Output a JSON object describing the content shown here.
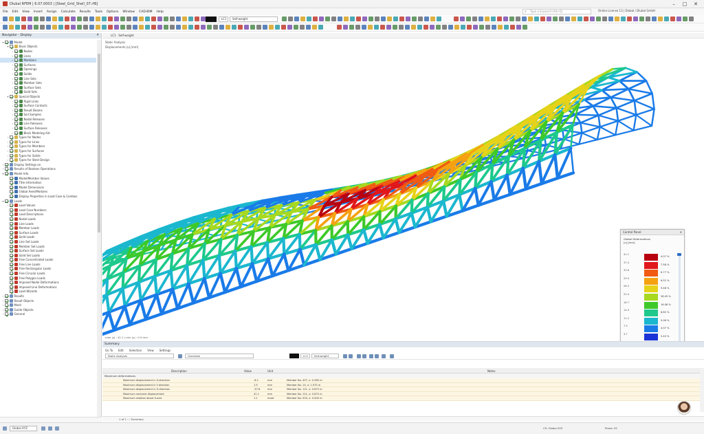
{
  "window": {
    "title": "Dlubal RFEM | 6.07.0003 | [Steel_Grid_Shell_07.rf6]",
    "controls": [
      "–",
      "□",
      "✕"
    ]
  },
  "menu": {
    "items": [
      "File",
      "Edit",
      "View",
      "Insert",
      "Assign",
      "Calculate",
      "Results",
      "Tools",
      "Options",
      "Window",
      "CAD-BIM",
      "Help"
    ],
    "search_placeholder": "Type a keyword (Alt+Q)",
    "license": "Online License 13 | Dlubal / Dlubal GmbH"
  },
  "toolbar": {
    "loadcase_code": "LC1",
    "loadcase_name": "Self-weight",
    "view_dropdown": "1 - Global XYZ"
  },
  "navigator": {
    "title": "Navigator - Display",
    "items": [
      {
        "label": "Model",
        "level": 0,
        "exp": "▾",
        "icon": "#6e8fbf"
      },
      {
        "label": "Basic Objects",
        "level": 1,
        "exp": "▾",
        "icon": "#d7b24a"
      },
      {
        "label": "Nodes",
        "level": 2,
        "exp": "›",
        "icon": "#4c8a4c"
      },
      {
        "label": "Lines",
        "level": 2,
        "exp": "›",
        "icon": "#4c8a4c"
      },
      {
        "label": "Members",
        "level": 2,
        "exp": "›",
        "icon": "#4c8a4c",
        "selected": true
      },
      {
        "label": "Surfaces",
        "level": 2,
        "exp": "›",
        "icon": "#4c8a4c"
      },
      {
        "label": "Openings",
        "level": 2,
        "exp": "›",
        "icon": "#4c8a4c"
      },
      {
        "label": "Solids",
        "level": 2,
        "exp": "›",
        "icon": "#4c8a4c"
      },
      {
        "label": "Line Sets",
        "level": 2,
        "exp": "›",
        "icon": "#4c8a4c"
      },
      {
        "label": "Member Sets",
        "level": 2,
        "exp": "›",
        "icon": "#4c8a4c"
      },
      {
        "label": "Surface Sets",
        "level": 2,
        "exp": "›",
        "icon": "#4c8a4c"
      },
      {
        "label": "Solid Sets",
        "level": 2,
        "exp": "›",
        "icon": "#4c8a4c"
      },
      {
        "label": "Special Objects",
        "level": 1,
        "exp": "▾",
        "icon": "#d7b24a"
      },
      {
        "label": "Rigid Links",
        "level": 2,
        "exp": "›",
        "icon": "#4c8a4c"
      },
      {
        "label": "Surface Contacts",
        "level": 2,
        "exp": "›",
        "icon": "#4c8a4c"
      },
      {
        "label": "Result Beams",
        "level": 2,
        "exp": "›",
        "icon": "#4c8a4c"
      },
      {
        "label": "Soil Samples",
        "level": 2,
        "exp": "›",
        "icon": "#4c8a4c"
      },
      {
        "label": "Nodal Releases",
        "level": 2,
        "exp": "›",
        "icon": "#4c8a4c"
      },
      {
        "label": "Line Releases",
        "level": 2,
        "exp": "›",
        "icon": "#4c8a4c"
      },
      {
        "label": "Surface Releases",
        "level": 2,
        "exp": "›",
        "icon": "#4c8a4c"
      },
      {
        "label": "Block Modeling Aid",
        "level": 2,
        "exp": "›",
        "icon": "#4c8a4c"
      },
      {
        "label": "Types for Nodes",
        "level": 1,
        "exp": "›",
        "icon": "#d7b24a"
      },
      {
        "label": "Types for Lines",
        "level": 1,
        "exp": "›",
        "icon": "#d7b24a"
      },
      {
        "label": "Types for Members",
        "level": 1,
        "exp": "›",
        "icon": "#d7b24a"
      },
      {
        "label": "Types for Surfaces",
        "level": 1,
        "exp": "›",
        "icon": "#d7b24a"
      },
      {
        "label": "Types for Solids",
        "level": 1,
        "exp": "›",
        "icon": "#d7b24a"
      },
      {
        "label": "Types for Steel Design",
        "level": 1,
        "exp": "›",
        "icon": "#d7b24a"
      },
      {
        "label": "Display Settings on",
        "level": 0,
        "exp": "›",
        "icon": "#6e8fbf"
      },
      {
        "label": "Results of Boolean Operations",
        "level": 0,
        "exp": "›",
        "icon": "#6e8fbf"
      },
      {
        "label": "Model Info",
        "level": 0,
        "exp": "▾",
        "icon": "#6e8fbf"
      },
      {
        "label": "Model/Member Values",
        "level": 1,
        "exp": "",
        "icon": "#3f6fb0"
      },
      {
        "label": "Title Information",
        "level": 1,
        "exp": "",
        "icon": "#3f6fb0"
      },
      {
        "label": "Model Dimensions",
        "level": 1,
        "exp": "",
        "icon": "#3f6fb0"
      },
      {
        "label": "Global Axes/Modules",
        "level": 1,
        "exp": "",
        "icon": "#3f6fb0"
      },
      {
        "label": "Display Properties in Load Case & Combos",
        "level": 1,
        "exp": "",
        "icon": "#3f6fb0"
      },
      {
        "label": "Loads",
        "level": 0,
        "exp": "▾",
        "icon": "#6e8fbf"
      },
      {
        "label": "Load Values",
        "level": 1,
        "exp": "›",
        "icon": "#c0392b"
      },
      {
        "label": "Load Case Numbers",
        "level": 1,
        "exp": "",
        "icon": "#c0392b"
      },
      {
        "label": "Load Descriptions",
        "level": 1,
        "exp": "",
        "icon": "#c0392b"
      },
      {
        "label": "Nodal Loads",
        "level": 1,
        "exp": "",
        "icon": "#c0392b"
      },
      {
        "label": "Line Loads",
        "level": 1,
        "exp": "",
        "icon": "#c0392b"
      },
      {
        "label": "Member Loads",
        "level": 1,
        "exp": "",
        "icon": "#c0392b"
      },
      {
        "label": "Surface Loads",
        "level": 1,
        "exp": "",
        "icon": "#c0392b"
      },
      {
        "label": "Solid Loads",
        "level": 1,
        "exp": "",
        "icon": "#c0392b"
      },
      {
        "label": "Line Set Loads",
        "level": 1,
        "exp": "",
        "icon": "#c0392b"
      },
      {
        "label": "Member Set Loads",
        "level": 1,
        "exp": "",
        "icon": "#c0392b"
      },
      {
        "label": "Surface Set Loads",
        "level": 1,
        "exp": "",
        "icon": "#c0392b"
      },
      {
        "label": "Solid Set Loads",
        "level": 1,
        "exp": "",
        "icon": "#c0392b"
      },
      {
        "label": "Free Concentrated Loads",
        "level": 1,
        "exp": "",
        "icon": "#c0392b"
      },
      {
        "label": "Free Line Loads",
        "level": 1,
        "exp": "",
        "icon": "#c0392b"
      },
      {
        "label": "Free Rectangular Loads",
        "level": 1,
        "exp": "",
        "icon": "#c0392b"
      },
      {
        "label": "Free Circular Loads",
        "level": 1,
        "exp": "",
        "icon": "#c0392b"
      },
      {
        "label": "Free Polygon Loads",
        "level": 1,
        "exp": "",
        "icon": "#c0392b"
      },
      {
        "label": "Imposed Nodal Deformations",
        "level": 1,
        "exp": "",
        "icon": "#c0392b"
      },
      {
        "label": "Imposed Line Deformations",
        "level": 1,
        "exp": "",
        "icon": "#c0392b"
      },
      {
        "label": "Load Wizards",
        "level": 1,
        "exp": "",
        "icon": "#c0392b"
      },
      {
        "label": "Results",
        "level": 0,
        "exp": "›",
        "icon": "#6e8fbf"
      },
      {
        "label": "Result Objects",
        "level": 0,
        "exp": "›",
        "icon": "#6e8fbf"
      },
      {
        "label": "Mesh",
        "level": 0,
        "exp": "›",
        "icon": "#6e8fbf"
      },
      {
        "label": "Guide Objects",
        "level": 0,
        "exp": "›",
        "icon": "#6e8fbf"
      },
      {
        "label": "General",
        "level": 0,
        "exp": "›",
        "icon": "#6e8fbf"
      }
    ]
  },
  "viewport": {
    "tab_label": "LC1 · Self-weight",
    "line1": "Static Analysis",
    "line2": "Displacements |u| [mm]",
    "footer": "max |u| : 41.1 | min |u| : 0.0 mm"
  },
  "control_panel": {
    "title": "Control Panel",
    "close": "✕",
    "subtitle1": "Global Deformations",
    "subtitle2": "|u| [mm]",
    "rows": [
      {
        "value": "41.1",
        "pct": "4.07 %",
        "color": "#b8000f"
      },
      {
        "value": "37.4",
        "pct": "7.58 %",
        "color": "#e0171b"
      },
      {
        "value": "33.6",
        "pct": "6.77 %",
        "color": "#f05a12"
      },
      {
        "value": "29.9",
        "pct": "6.52 %",
        "color": "#f5a111"
      },
      {
        "value": "26.2",
        "pct": "9.48 %",
        "color": "#e7d21a"
      },
      {
        "value": "22.4",
        "pct": "28.05 %",
        "color": "#a8d91f"
      },
      {
        "value": "18.7",
        "pct": "16.08 %",
        "color": "#3ec929"
      },
      {
        "value": "14.9",
        "pct": "8.82 %",
        "color": "#1dc98c"
      },
      {
        "value": "11.2",
        "pct": "5.08 %",
        "color": "#1bb7cf"
      },
      {
        "value": "7.5",
        "pct": "4.07 %",
        "color": "#1a7be8"
      },
      {
        "value": "3.7",
        "pct": "3.45 %",
        "color": "#1c34d6"
      },
      {
        "value": "0.0",
        "pct": "2.53 %",
        "color": "#121a9f"
      }
    ]
  },
  "summary": {
    "title": "Summary",
    "menu": [
      "Go To",
      "Edit",
      "Selection",
      "View",
      "Settings"
    ],
    "analysis_dropdown": "Static Analysis",
    "overview_dropdown": "Overview",
    "lc_code": "LC1",
    "lc_name": "Self-weight",
    "columns": {
      "description": "Description",
      "value": "Value",
      "unit": "Unit",
      "notes": "Notes"
    },
    "section": "Maximum deformations",
    "rows": [
      {
        "description": "Maximum displacement in X-direction",
        "value": "-8.1",
        "unit": "mm",
        "notes": "Member No. 457, x: 0.285 m"
      },
      {
        "description": "Maximum displacement in Y-direction",
        "value": "1.9",
        "unit": "mm",
        "notes": "Member No. 15, x: 1.975 m"
      },
      {
        "description": "Maximum displacement in Z-direction",
        "value": "-37.6",
        "unit": "mm",
        "notes": "Member No. 121, x: 0.875 m"
      },
      {
        "description": "Maximum vectorial displacement",
        "value": "41.1",
        "unit": "mm",
        "notes": "Member No. 121, x: 0.875 m"
      },
      {
        "description": "Maximum rotation about X-axis",
        "value": "1.1",
        "unit": "mrad",
        "notes": "Member No. 503, x: 0.000 m"
      }
    ]
  },
  "pagetabs": "1 of 1   ‹  ›   Summary",
  "statusbar": {
    "dropdown": "Global XYZ",
    "right1": "CS: Global XYZ",
    "right2": "Plane: XY"
  }
}
